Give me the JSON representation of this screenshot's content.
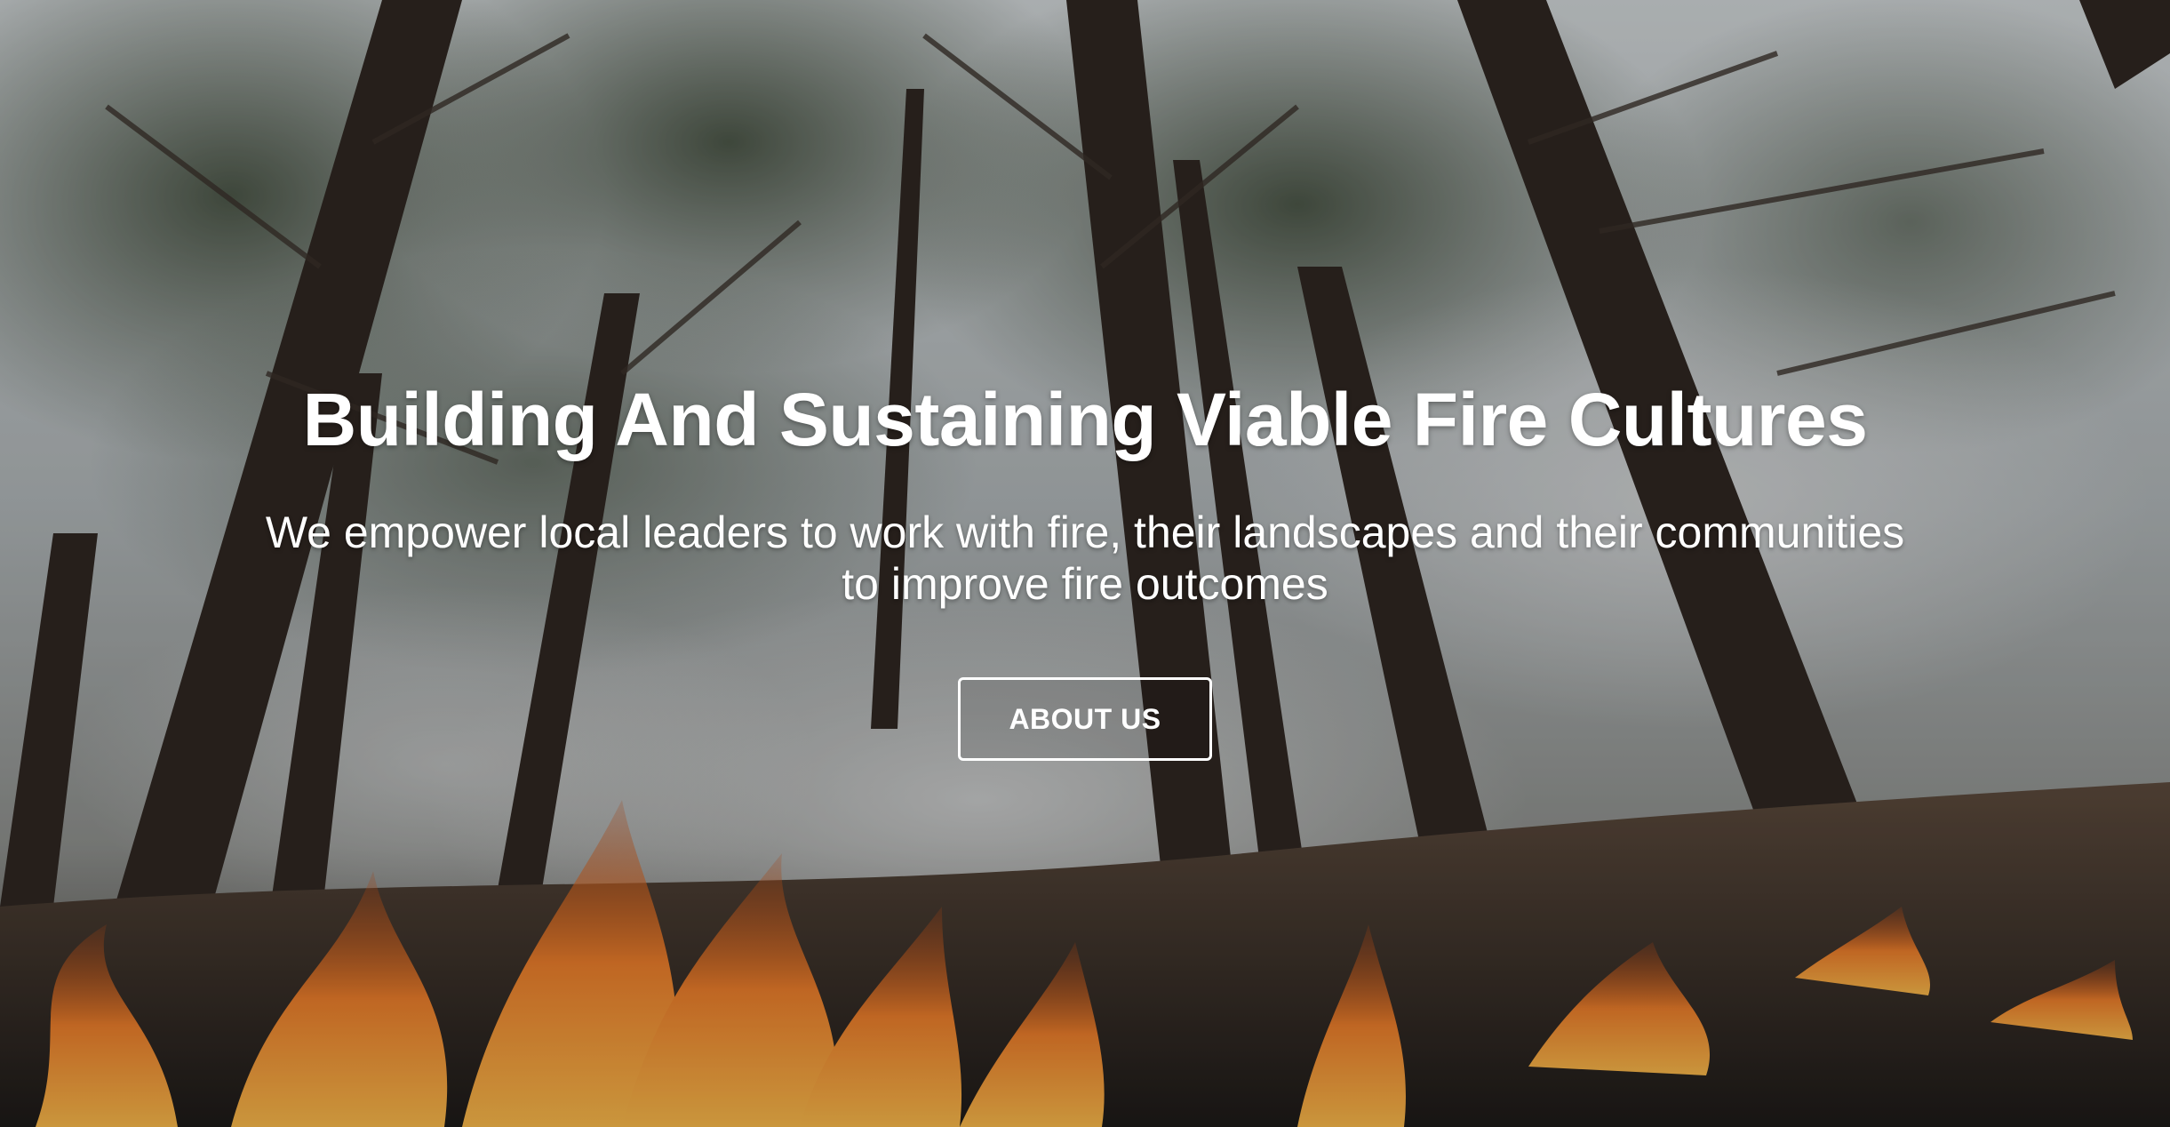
{
  "hero": {
    "title": "Building And Sustaining Viable Fire Cultures",
    "subtitle_line1": "We empower local leaders to work with fire, their landscapes and their communities",
    "subtitle_line2": "to improve fire outcomes",
    "button_label": "ABOUT US",
    "background_image": "forest-fire-photo"
  },
  "colors": {
    "text": "#ffffff",
    "button_border": "#ffffff"
  }
}
